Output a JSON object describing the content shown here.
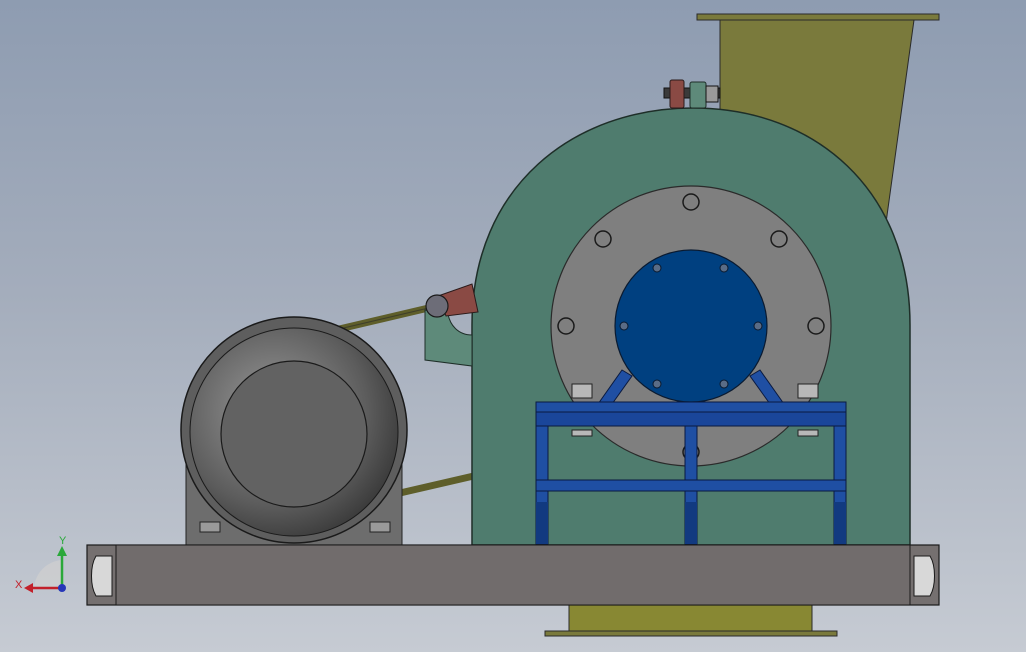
{
  "viewport": {
    "background_top": "#8e9cb1",
    "background_bottom": "#c6cbd3"
  },
  "triad": {
    "x_label": "X",
    "y_label": "Y",
    "x_color": "#c2202a",
    "y_color": "#2aa83a",
    "z_color": "#2636b8"
  },
  "model": {
    "housing_color": "#4f7c6e",
    "end_plate_color": "#7f7f7f",
    "cover_color": "#004080",
    "stand_color": "#1f4fa3",
    "hopper_color": "#7a7a3c",
    "motor_color": "#6d6d6d",
    "base_color": "#757070",
    "tensioner_color": "#8a4a44"
  }
}
